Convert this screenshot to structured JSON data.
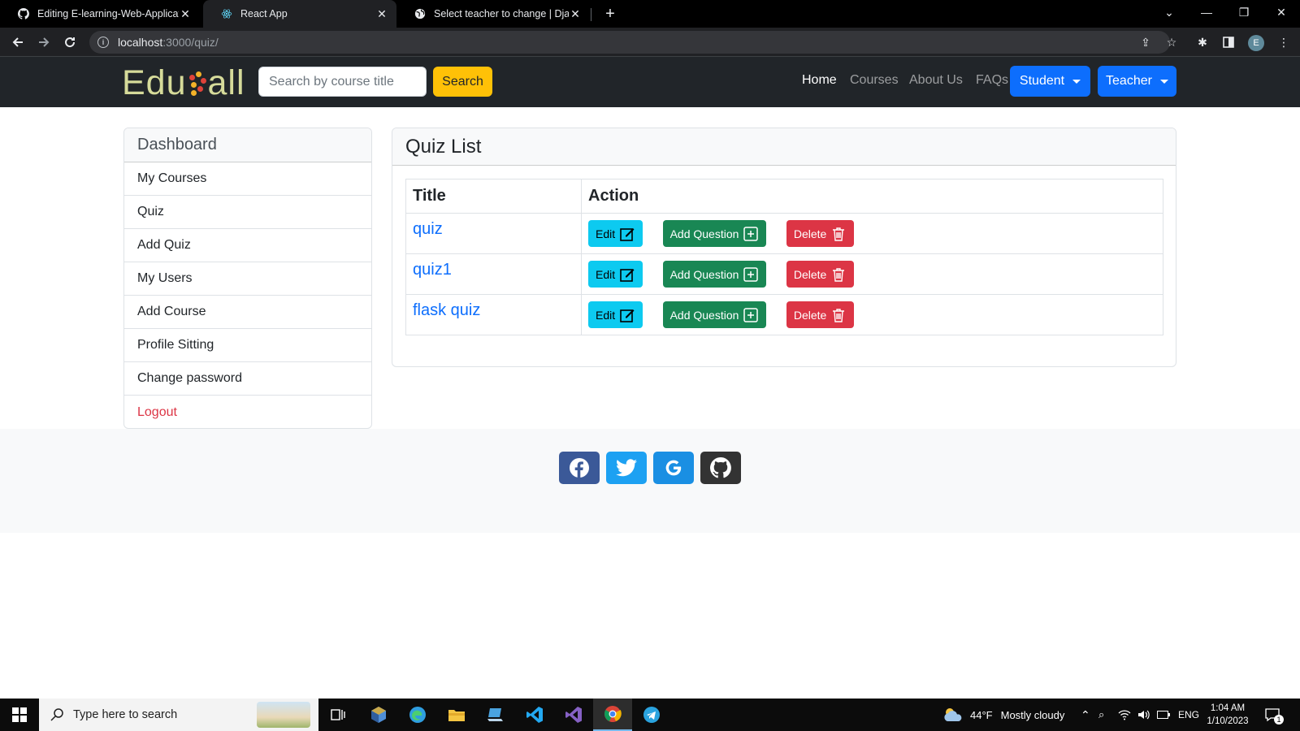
{
  "browser": {
    "tabs": [
      {
        "title": "Editing E-learning-Web-Applicati",
        "icon": "github-icon"
      },
      {
        "title": "React App",
        "icon": "react-icon"
      },
      {
        "title": "Select teacher to change | Djang",
        "icon": "globe-icon"
      }
    ],
    "url_host": "localhost",
    "url_rest": ":3000/quiz/",
    "profile_initial": "E"
  },
  "navbar": {
    "brand_left": "Edu",
    "brand_right": "all",
    "search_placeholder": "Search by course title",
    "search_button": "Search",
    "links": [
      "Home",
      "Courses",
      "About Us",
      "FAQs"
    ],
    "student_dropdown": "Student",
    "teacher_dropdown": "Teacher"
  },
  "sidebar": {
    "title": "Dashboard",
    "items": [
      "My Courses",
      "Quiz",
      "Add Quiz",
      "My Users",
      "Add Course",
      "Profile Sitting",
      "Change password",
      "Logout"
    ]
  },
  "quiz_card": {
    "title": "Quiz List",
    "columns": [
      "Title",
      "Action"
    ],
    "rows": [
      {
        "title": "quiz"
      },
      {
        "title": "quiz1"
      },
      {
        "title": "flask quiz"
      }
    ],
    "actions": {
      "edit": "Edit",
      "add_question": "Add Question",
      "delete": "Delete"
    }
  },
  "footer": {
    "social": [
      "facebook-icon",
      "twitter-icon",
      "google-icon",
      "github-icon"
    ]
  },
  "taskbar": {
    "search_placeholder": "Type here to search",
    "weather_temp": "44°F",
    "weather_text": "Mostly cloudy",
    "language": "ENG",
    "time": "1:04 AM",
    "date": "1/10/2023",
    "notification_count": "1"
  },
  "colors": {
    "primary": "#0d6efd",
    "warning": "#ffc107",
    "info": "#0dcaf0",
    "success": "#198754",
    "danger": "#dc3545",
    "dark": "#212529"
  }
}
